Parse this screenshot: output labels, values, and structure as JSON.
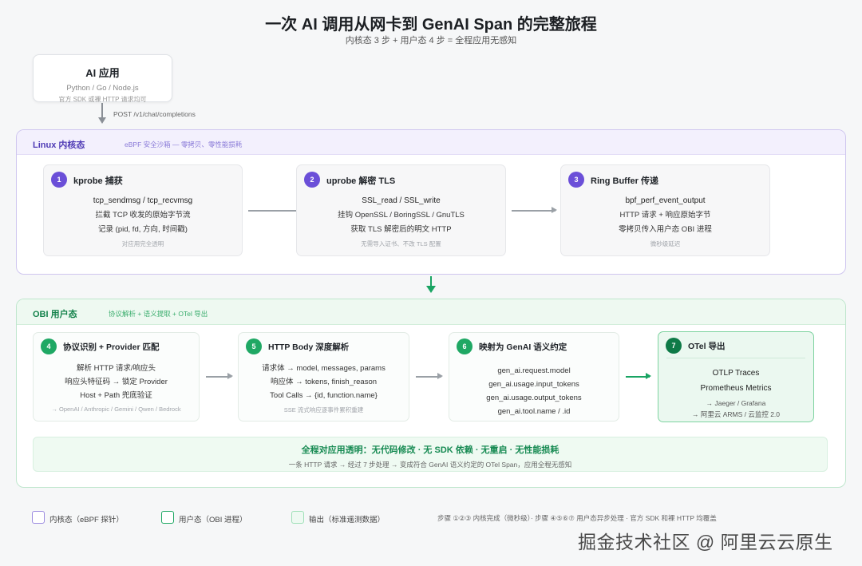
{
  "title": "一次 AI 调用从网卡到 GenAI Span 的完整旅程",
  "subtitle": "内核态 3 步 + 用户态 4 步 = 全程应用无感知",
  "app": {
    "title": "AI 应用",
    "langs": "Python / Go / Node.js",
    "note": "官方 SDK 或裸 HTTP 请求均可",
    "request": "POST /v1/chat/completions"
  },
  "kernel": {
    "title": "Linux 内核态",
    "note": "eBPF 安全沙箱 — 零拷贝、零性能损耗",
    "steps": [
      {
        "num": "1",
        "title": "kprobe 捕获",
        "lines": [
          "tcp_sendmsg / tcp_recvmsg",
          "拦截 TCP 收发的原始字节流",
          "记录 (pid, fd, 方向, 时间戳)"
        ],
        "foot": "对应用完全透明"
      },
      {
        "num": "2",
        "title": "uprobe 解密 TLS",
        "lines": [
          "SSL_read / SSL_write",
          "挂钩 OpenSSL / BoringSSL / GnuTLS",
          "获取 TLS 解密后的明文 HTTP"
        ],
        "foot": "无需导入证书、不改 TLS 配置"
      },
      {
        "num": "3",
        "title": "Ring Buffer 传递",
        "lines": [
          "bpf_perf_event_output",
          "HTTP 请求 + 响应原始字节",
          "零拷贝传入用户态 OBI 进程"
        ],
        "foot": "微秒级延迟"
      }
    ]
  },
  "user": {
    "title": "OBI 用户态",
    "note": "协议解析 + 语义提取 + OTel 导出",
    "steps": [
      {
        "num": "4",
        "title": "协议识别 + Provider 匹配",
        "lines": [
          "解析 HTTP 请求/响应头",
          "响应头特征码 → 锁定 Provider",
          "Host + Path 兜底验证"
        ],
        "foot": "→ OpenAI / Anthropic / Gemini / Qwen / Bedrock"
      },
      {
        "num": "5",
        "title": "HTTP Body 深度解析",
        "lines": [
          "请求体 → model, messages, params",
          "响应体 → tokens, finish_reason",
          "Tool Calls → {id, function.name}"
        ],
        "foot": "SSE 流式响应逐事件累积重建"
      },
      {
        "num": "6",
        "title": "映射为 GenAI 语义约定",
        "lines": [
          "gen_ai.request.model",
          "gen_ai.usage.input_tokens",
          "gen_ai.usage.output_tokens",
          "gen_ai.tool.name / .id"
        ],
        "foot": ""
      },
      {
        "num": "7",
        "title": "OTel 导出",
        "lines": [
          "OTLP Traces",
          "Prometheus Metrics"
        ],
        "targets": [
          "→ Jaeger / Grafana",
          "→ 阿里云 ARMS / 云监控 2.0"
        ]
      }
    ],
    "banner_main": "全程对应用透明：无代码修改 · 无 SDK 依赖 · 无重启 · 无性能损耗",
    "banner_sub": "一条 HTTP 请求 → 经过 7 步处理 → 变成符合 GenAI 语义约定的 OTel Span，应用全程无感知"
  },
  "legend": {
    "kernel": "内核态（eBPF 探针）",
    "user": "用户态（OBI 进程）",
    "output": "输出（标准遥测数据）",
    "note": "步骤 ①②③ 内核完成（微秒级）· 步骤 ④⑤⑥⑦ 用户态异步处理 · 官方 SDK 和裸 HTTP 均覆盖"
  },
  "watermark": "掘金技术社区 @ 阿里云云原生",
  "colors": {
    "kernel_accent": "#6b4fd8",
    "user_accent": "#1fa864",
    "output_accent": "#0e7a47"
  }
}
